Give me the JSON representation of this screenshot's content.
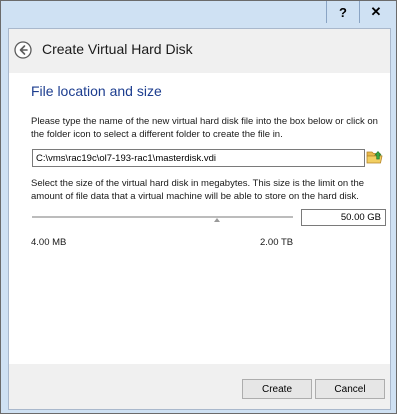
{
  "window": {
    "help_label": "?",
    "close_label": "✕"
  },
  "header": {
    "back_icon": "back-arrow-icon",
    "title": "Create Virtual Hard Disk"
  },
  "file_location": {
    "title": "File location and size",
    "description": "Please type the name of the new virtual hard disk file into the box below or click on the folder icon to select a different folder to create the file in.",
    "path_value": "C:\\vms\\rac19c\\ol7-193-rac1\\masterdisk.vdi",
    "folder_icon": "folder-icon"
  },
  "size": {
    "description": "Select the size of the virtual hard disk in megabytes. This size is the limit on the amount of file data that a virtual machine will be able to store on the hard disk.",
    "value": "50.00 GB",
    "slider_fraction": 0.71,
    "min_label": "4.00 MB",
    "max_label": "2.00 TB"
  },
  "footer": {
    "create_label": "Create",
    "cancel_label": "Cancel"
  }
}
